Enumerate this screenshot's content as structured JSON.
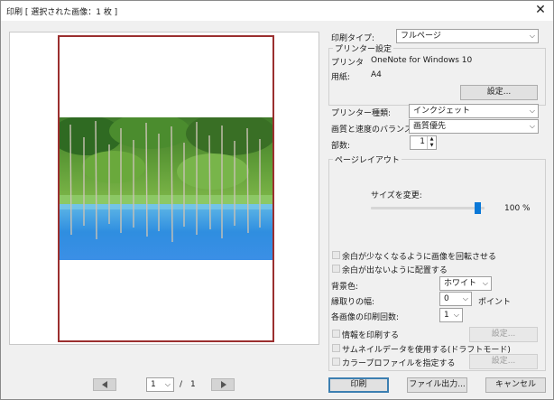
{
  "window": {
    "title": "印刷 [ 選択された画像：1 枚 ]",
    "close_glyph": "✕"
  },
  "nav": {
    "page_current": "1",
    "page_separator": "/",
    "page_total": "1"
  },
  "print_type": {
    "label": "印刷タイプ:",
    "value": "フルページ"
  },
  "printer_settings": {
    "group_label": "プリンター設定",
    "printer_label": "プリンタ",
    "printer_value": "OneNote for Windows 10",
    "paper_label": "用紙:",
    "paper_value": "A4",
    "settings_button": "設定..."
  },
  "printer_type": {
    "label": "プリンター種類:",
    "value": "インクジェット"
  },
  "quality": {
    "label": "画質と速度のバランス:",
    "value": "画質優先"
  },
  "copies": {
    "label": "部数:",
    "value": "1"
  },
  "page_layout": {
    "group_label": "ページレイアウト",
    "resize_label": "サイズを変更:",
    "resize_value": "100 %",
    "resize_fraction": 1.0,
    "rotate_label": "余白が少なくなるように画像を回転させる",
    "no_margin_label": "余白が出ないように配置する",
    "background_label": "背景色:",
    "background_value": "ホワイト",
    "border_label": "縁取りの幅:",
    "border_value": "0",
    "border_unit": "ポイント",
    "repeat_label": "各画像の印刷回数:",
    "repeat_value": "1"
  },
  "options": {
    "print_info_label": "情報を印刷する",
    "print_info_settings": "設定...",
    "thumbnail_label": "サムネイルデータを使用する(ドラフトモード)",
    "color_profile_label": "カラープロファイルを指定する",
    "color_profile_settings": "設定..."
  },
  "buttons": {
    "print": "印刷",
    "file_output": "ファイル出力...",
    "cancel": "キャンセル"
  },
  "colors": {
    "accent": "#0a78d7",
    "paper_border": "#9b2f2f"
  }
}
